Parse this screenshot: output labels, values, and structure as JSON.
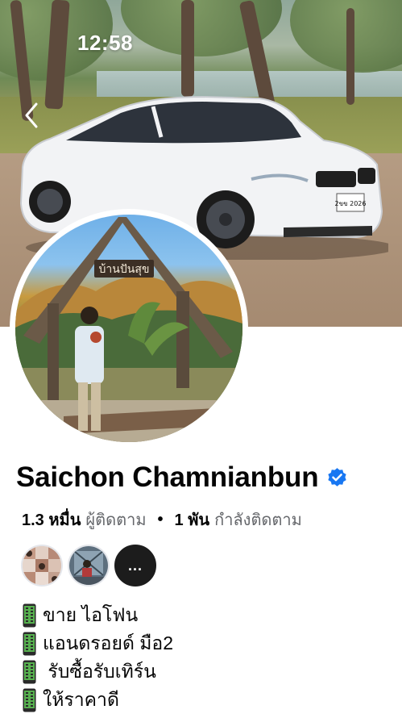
{
  "status_bar": {
    "time": "12:58"
  },
  "navigation": {
    "back_icon": "chevron-left-icon"
  },
  "cover": {
    "photo": "white-sedan-in-park",
    "plate_text": "2ขข 2026"
  },
  "profile_photo": {
    "sign_text": "บ้านปันสุข"
  },
  "profile": {
    "name": "Saichon Chamnianbun",
    "verified_icon": "verified-badge-icon",
    "verified_color": "#1877f2"
  },
  "stats": {
    "followers_count": "1.3 หมื่น",
    "followers_label": "ผู้ติดตาม",
    "separator": "•",
    "following_count": "1 พัน",
    "following_label": "กำลังติดตาม"
  },
  "friends": {
    "avatars": [
      "friend-avatar-1",
      "friend-avatar-2"
    ],
    "more_label": "..."
  },
  "bio": {
    "icon": "mobile-phone-icon",
    "lines": [
      "ขาย ไอโฟน",
      "แอนดรอยด์ มือ2",
      " รับซื้อรับเทิร์น",
      "ให้ราคาดี"
    ]
  },
  "colors": {
    "text_primary": "#050505",
    "text_secondary": "#65676b",
    "accent": "#1877f2"
  }
}
